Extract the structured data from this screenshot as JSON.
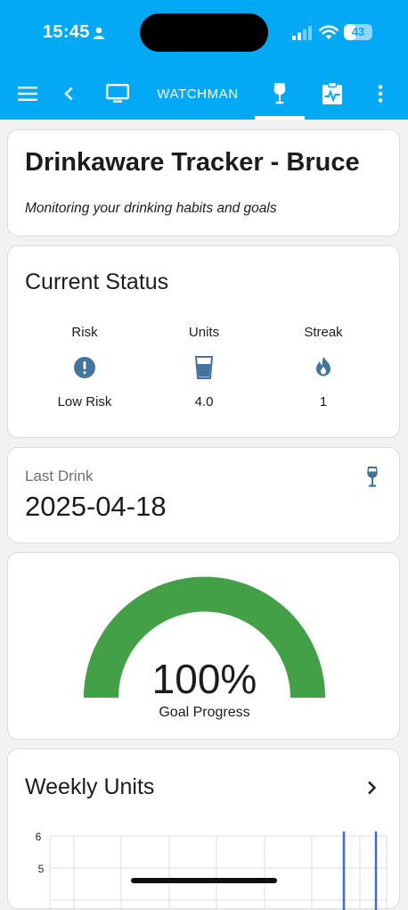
{
  "status_bar": {
    "time": "15:45",
    "battery": "43",
    "battery_level": 0.43
  },
  "toolbar": {
    "view_label": "WATCHMAN"
  },
  "header_card": {
    "title": "Drinkaware Tracker - Bruce",
    "subtitle": "Monitoring your drinking habits and goals"
  },
  "current_status": {
    "heading": "Current Status",
    "columns": [
      {
        "label": "Risk",
        "icon": "alert-circle-icon",
        "value": "Low Risk"
      },
      {
        "label": "Units",
        "icon": "cup-icon",
        "value": "4.0"
      },
      {
        "label": "Streak",
        "icon": "fire-icon",
        "value": "1"
      }
    ]
  },
  "last_drink": {
    "label": "Last Drink",
    "value": "2025-04-18",
    "icon": "wine-glass-icon"
  },
  "goal_gauge": {
    "value_text": "100%",
    "value": 100,
    "name": "Goal Progress",
    "color": "#43a047"
  },
  "weekly_units": {
    "heading": "Weekly Units",
    "chart_data": {
      "type": "line",
      "ylabel": "",
      "yticks": [
        "6",
        "5"
      ],
      "series_color": "#3f6fc4"
    }
  },
  "colors": {
    "accent": "#03a9f4",
    "icon_blue": "#44739e",
    "gauge_green": "#43a047"
  }
}
